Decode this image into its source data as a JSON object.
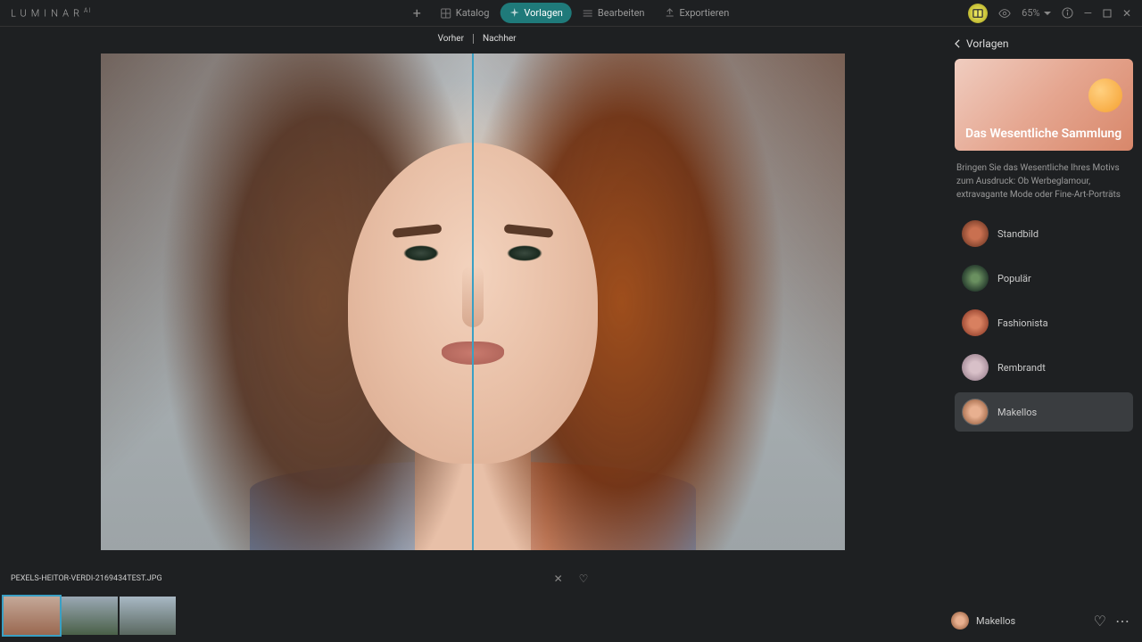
{
  "app": {
    "name": "LUMINAR",
    "suffix": "AI"
  },
  "topnav": {
    "katalog": "Katalog",
    "vorlagen": "Vorlagen",
    "bearbeiten": "Bearbeiten",
    "exportieren": "Exportieren"
  },
  "zoom": {
    "value": "65%"
  },
  "compare": {
    "before": "Vorher",
    "after": "Nachher"
  },
  "panel": {
    "back_label": "Vorlagen",
    "collection_title": "Das Wesentliche Sammlung",
    "collection_desc": "Bringen Sie das Wesentliche Ihres Motivs zum Ausdruck: Ob Werbeglamour, extravagante Mode oder Fine-Art-Porträts",
    "templates": [
      {
        "name": "Standbild"
      },
      {
        "name": "Populär"
      },
      {
        "name": "Fashionista"
      },
      {
        "name": "Rembrandt"
      },
      {
        "name": "Makellos"
      }
    ],
    "selected_index": 4
  },
  "filmstrip": {
    "filename": "PEXELS-HEITOR-VERDI-2169434TEST.JPG"
  },
  "applied": {
    "name": "Makellos"
  }
}
